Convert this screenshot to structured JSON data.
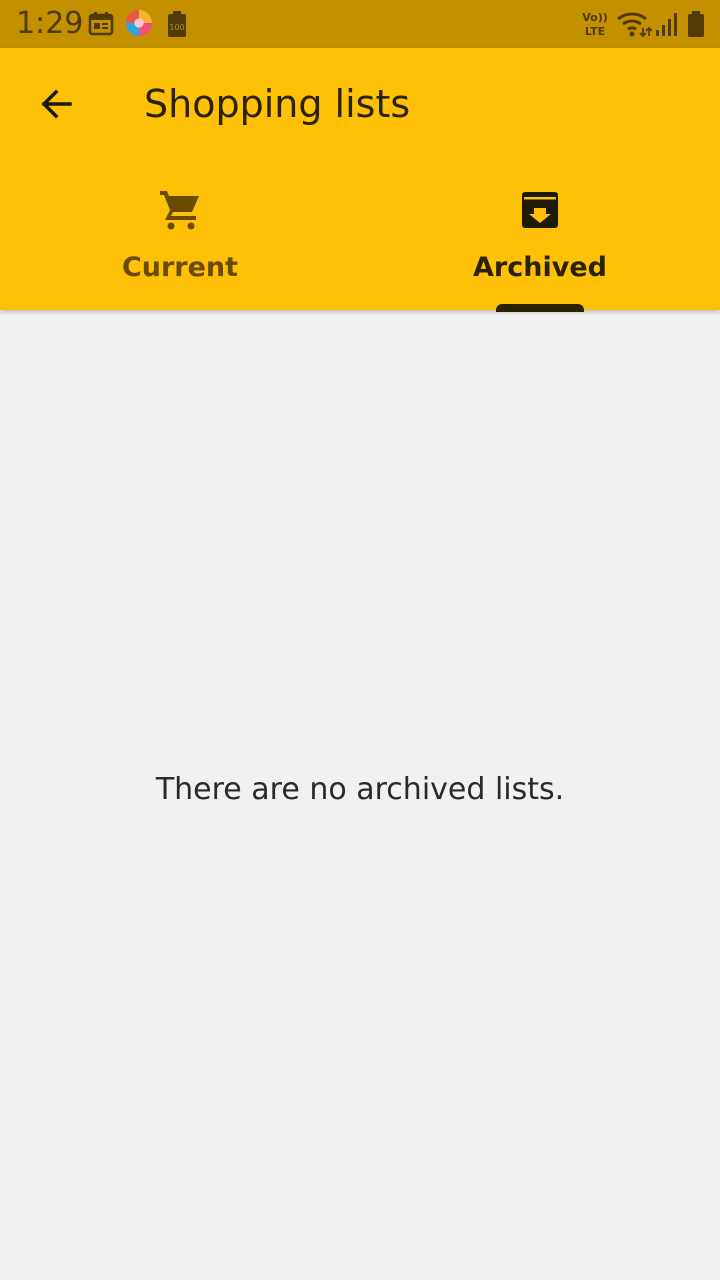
{
  "status_bar": {
    "time": "1:29",
    "icons": [
      "calendar-icon",
      "photos-app-icon",
      "battery-saver-icon",
      "volte-icon",
      "wifi-icon",
      "cell-signal-icon",
      "battery-icon"
    ],
    "battery_saver_text": "100",
    "volte_top": "Vo))",
    "volte_bottom": "LTE"
  },
  "app_bar": {
    "title": "Shopping lists",
    "back_icon": "arrow-back-icon",
    "background": "#ffc107",
    "status_background": "#c49000"
  },
  "tabs": [
    {
      "label": "Current",
      "icon": "shopping-cart-icon",
      "selected": false
    },
    {
      "label": "Archived",
      "icon": "archive-icon",
      "selected": true
    }
  ],
  "main": {
    "empty_message": "There are no archived lists."
  }
}
